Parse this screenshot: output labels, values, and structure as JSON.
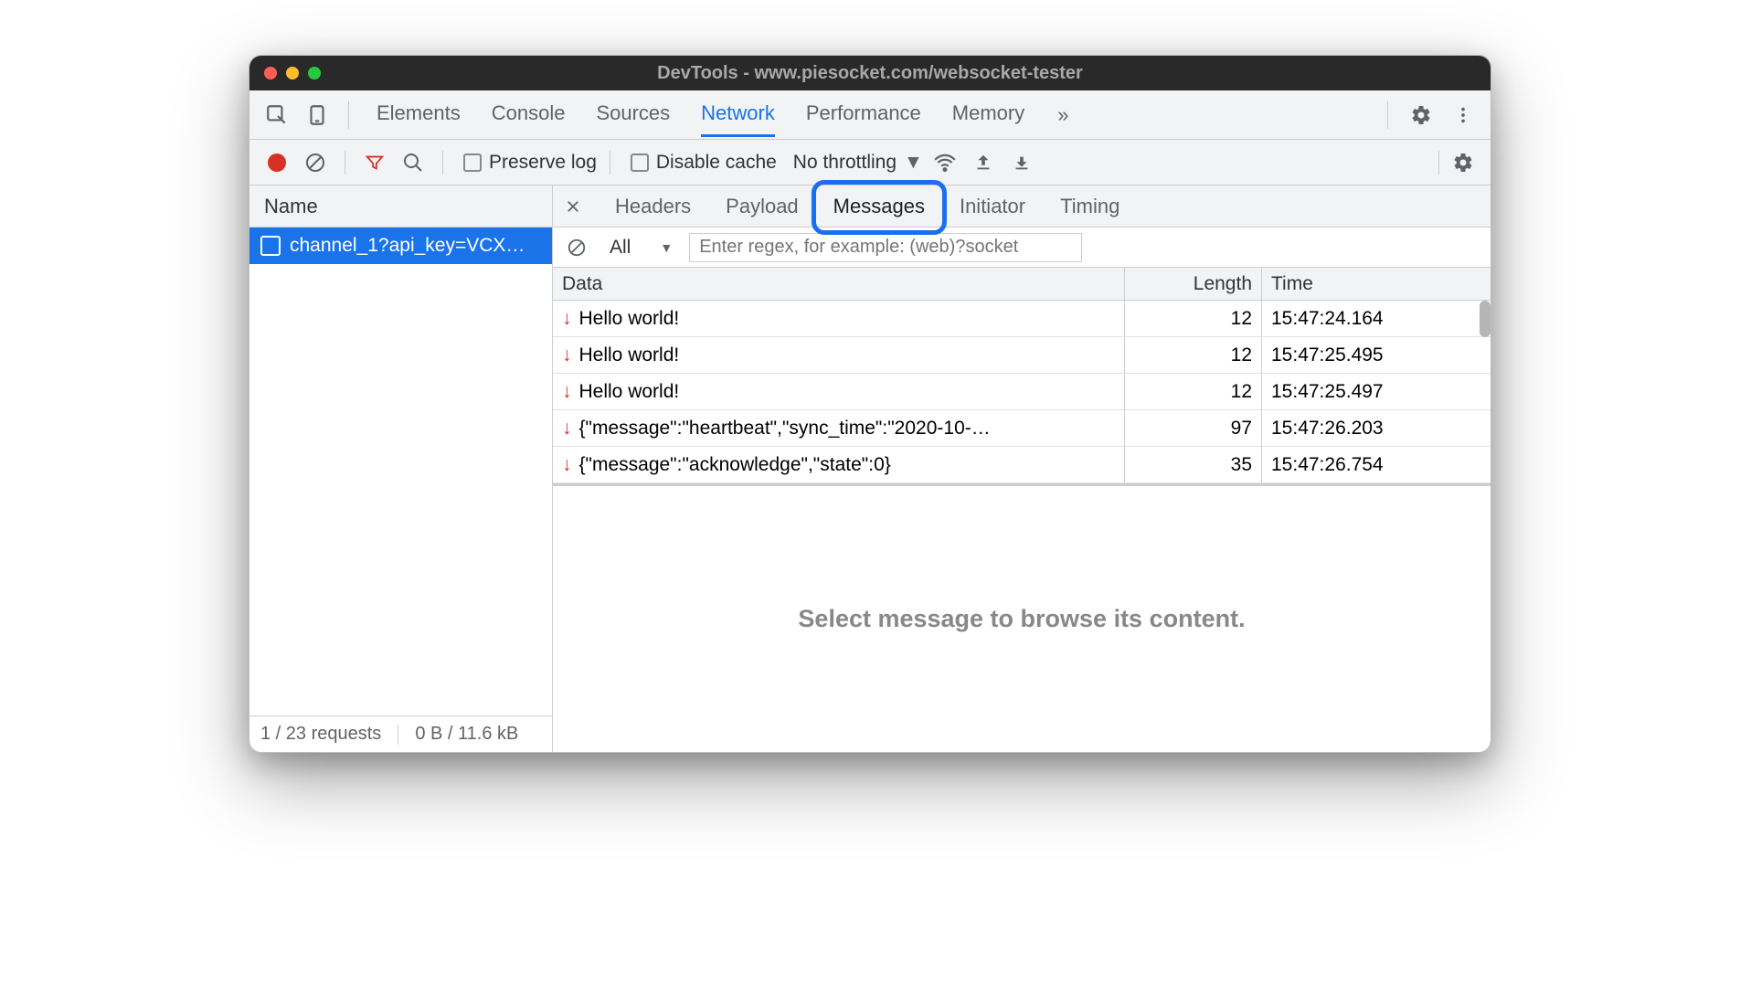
{
  "window": {
    "title": "DevTools - www.piesocket.com/websocket-tester"
  },
  "panels": {
    "items": [
      "Elements",
      "Console",
      "Sources",
      "Network",
      "Performance",
      "Memory"
    ],
    "active": "Network",
    "more": "»"
  },
  "toolbar": {
    "preserve_log": "Preserve log",
    "disable_cache": "Disable cache",
    "throttling": "No throttling"
  },
  "sidebar": {
    "header": "Name",
    "requests": [
      "channel_1?api_key=VCX…"
    ],
    "status": {
      "count": "1 / 23 requests",
      "size": "0 B / 11.6 kB"
    }
  },
  "detail": {
    "tabs": [
      "Headers",
      "Payload",
      "Messages",
      "Initiator",
      "Timing"
    ],
    "active": "Messages",
    "filter": {
      "all": "All",
      "placeholder": "Enter regex, for example: (web)?socket"
    },
    "columns": {
      "data": "Data",
      "length": "Length",
      "time": "Time"
    },
    "rows": [
      {
        "data": "Hello world!",
        "length": "12",
        "time": "15:47:24.164"
      },
      {
        "data": "Hello world!",
        "length": "12",
        "time": "15:47:25.495"
      },
      {
        "data": "Hello world!",
        "length": "12",
        "time": "15:47:25.497"
      },
      {
        "data": "{\"message\":\"heartbeat\",\"sync_time\":\"2020-10-…",
        "length": "97",
        "time": "15:47:26.203"
      },
      {
        "data": "{\"message\":\"acknowledge\",\"state\":0}",
        "length": "35",
        "time": "15:47:26.754"
      }
    ],
    "preview_hint": "Select message to browse its content."
  }
}
